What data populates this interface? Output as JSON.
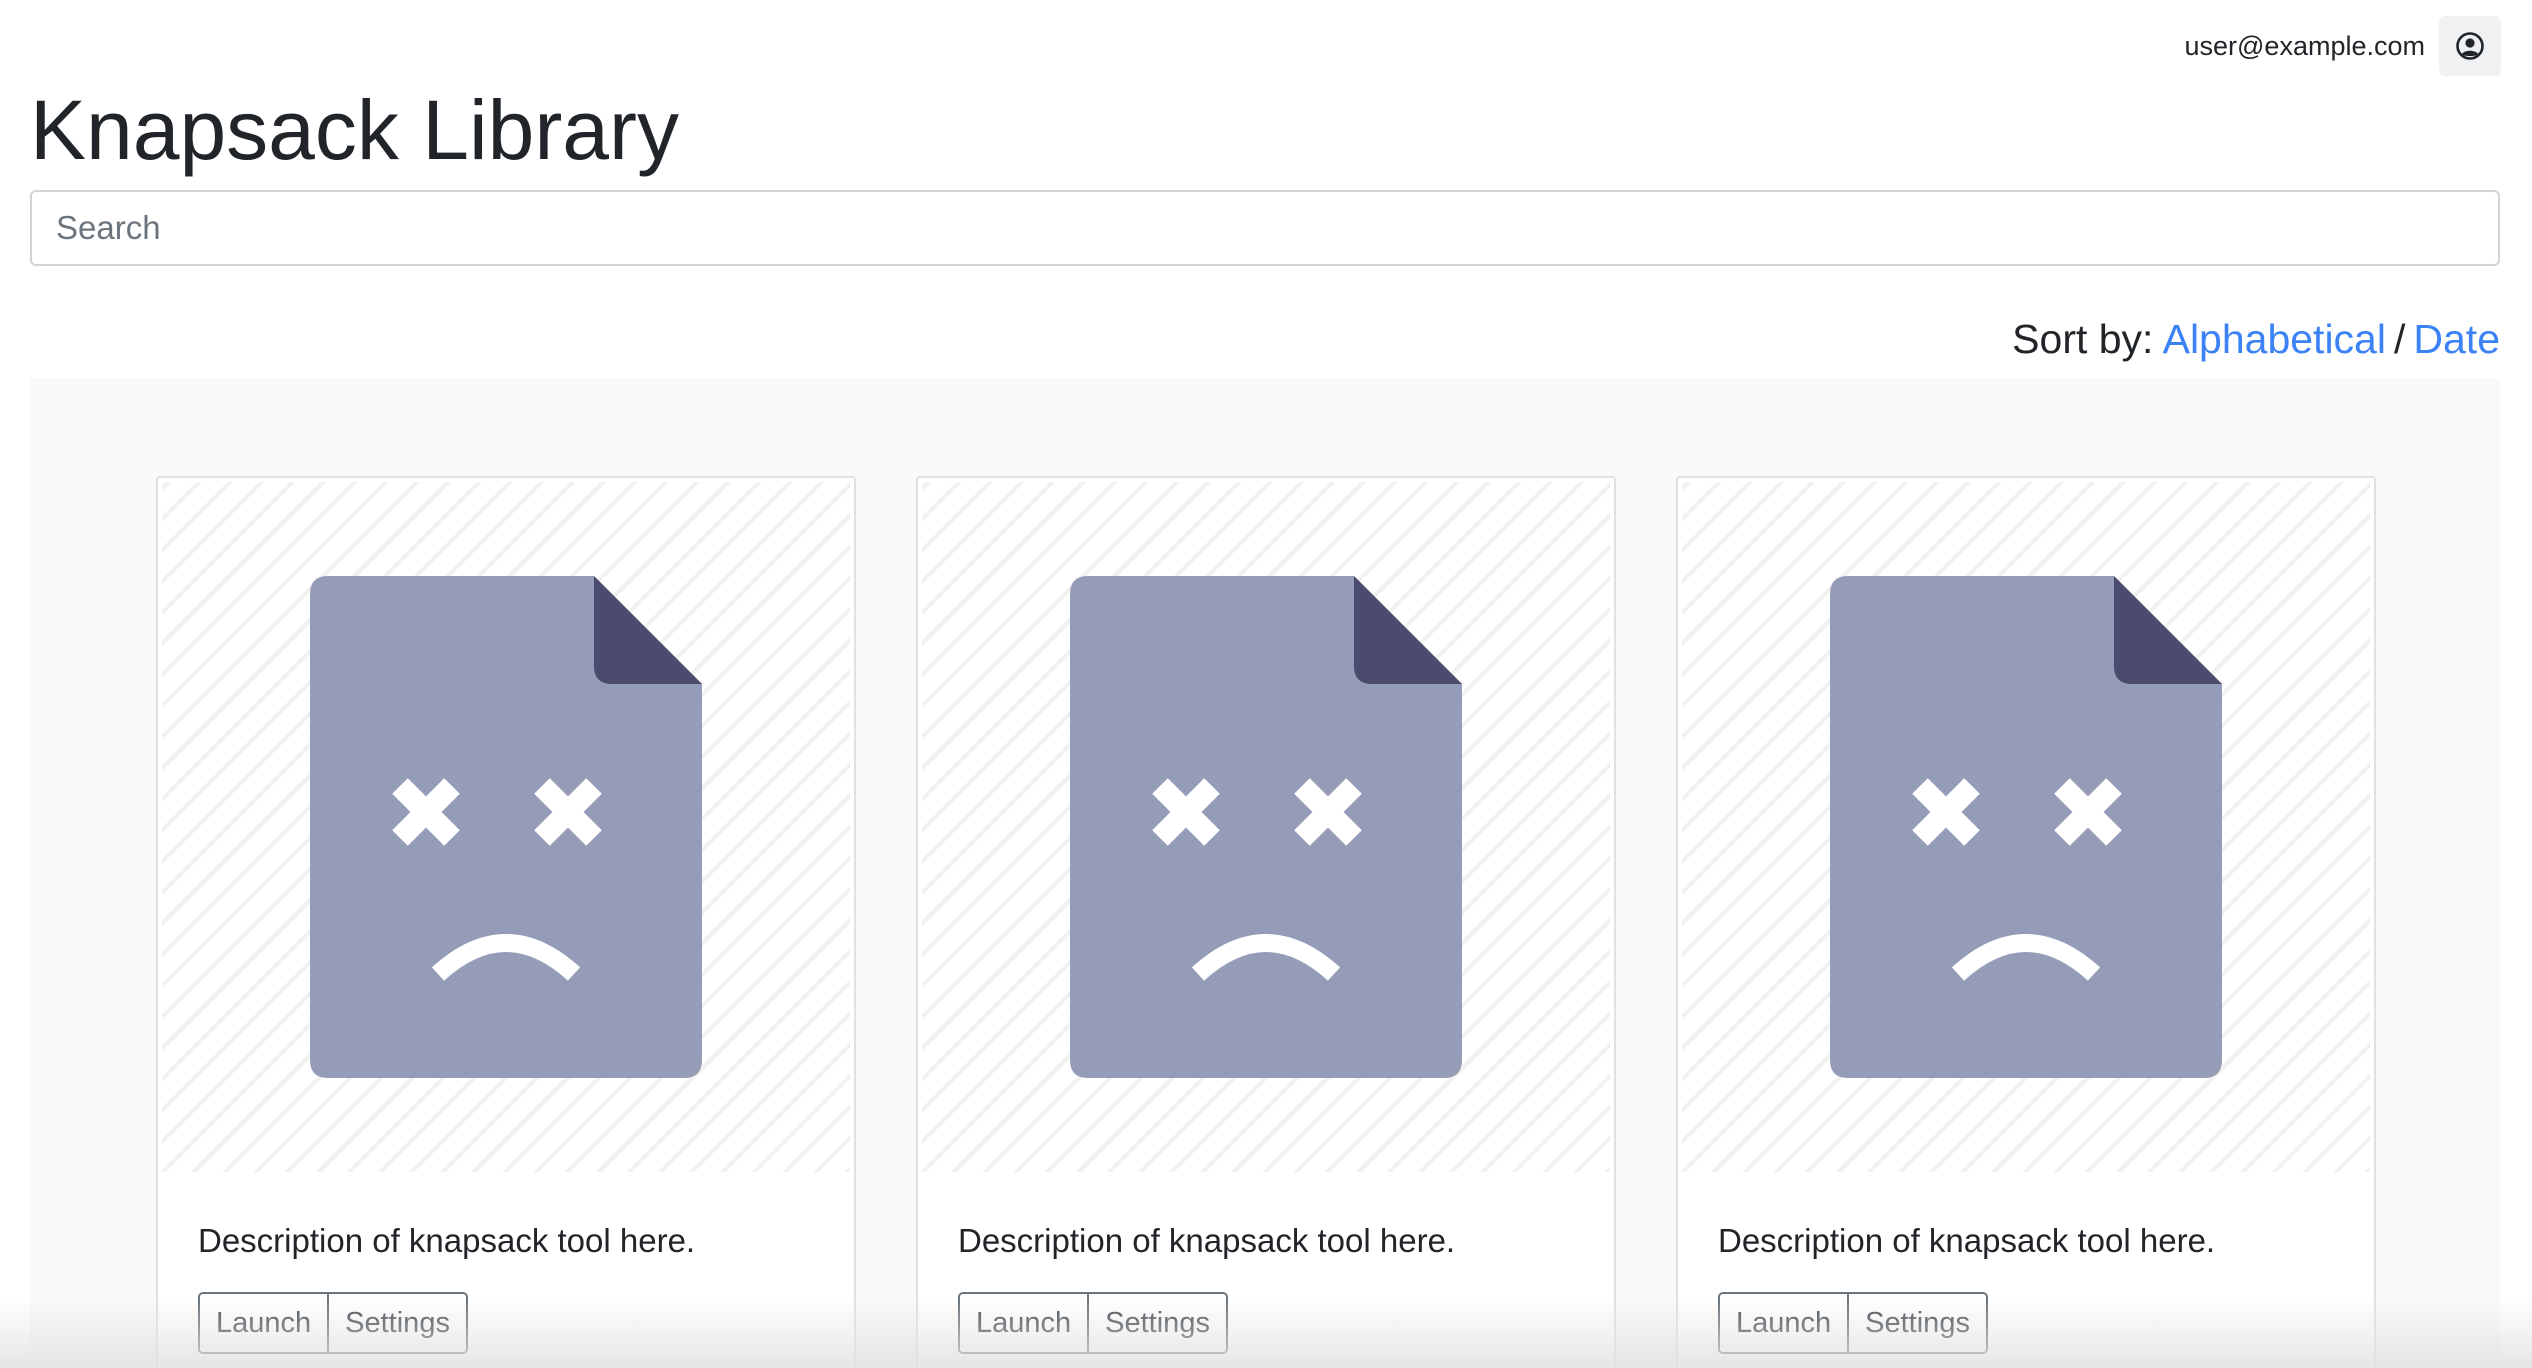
{
  "header": {
    "user_email": "user@example.com",
    "user_icon": "user-circle-icon",
    "title": "Knapsack Library"
  },
  "search": {
    "placeholder": "Search",
    "value": ""
  },
  "sort": {
    "label": "Sort by:",
    "options": [
      "Alphabetical",
      "Date"
    ],
    "separator": "/"
  },
  "colors": {
    "link": "#3b82f6",
    "icon_body": "#949cb8",
    "icon_fold": "#4b4b6e",
    "grid_bg": "#f8f9fa"
  },
  "cards": [
    {
      "image_icon": "broken-file-sad-icon",
      "description": "Description of knapsack tool here.",
      "launch_label": "Launch",
      "settings_label": "Settings"
    },
    {
      "image_icon": "broken-file-sad-icon",
      "description": "Description of knapsack tool here.",
      "launch_label": "Launch",
      "settings_label": "Settings"
    },
    {
      "image_icon": "broken-file-sad-icon",
      "description": "Description of knapsack tool here.",
      "launch_label": "Launch",
      "settings_label": "Settings"
    }
  ]
}
